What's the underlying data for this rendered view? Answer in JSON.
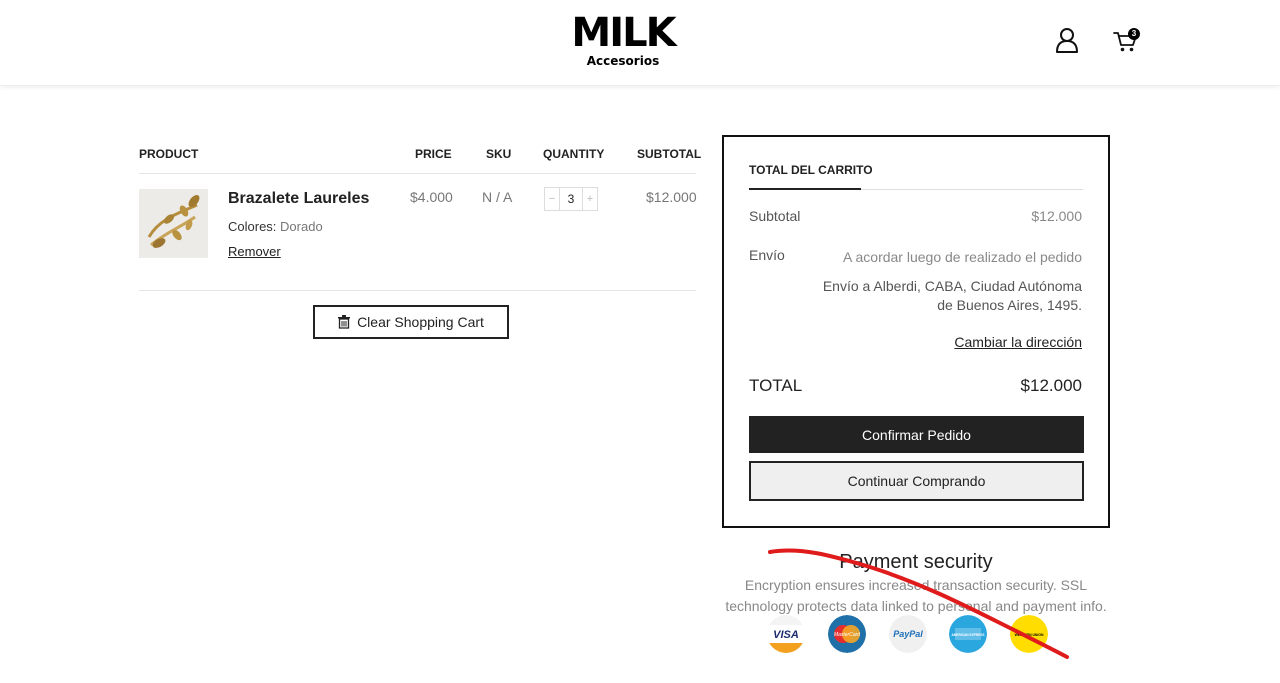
{
  "header": {
    "logo_main": "MILK",
    "logo_sub": "Accesorios",
    "cart_count": "3"
  },
  "cart_table": {
    "headers": {
      "product": "PRODUCT",
      "price": "PRICE",
      "sku": "SKU",
      "quantity": "QUANTITY",
      "subtotal": "SUBTOTAL"
    },
    "item": {
      "name": "Brazalete Laureles",
      "attr_label": "Colores:",
      "attr_value": "Dorado",
      "remove_label": "Remover",
      "price": "$4.000",
      "sku": "N / A",
      "quantity": "3",
      "subtotal": "$12.000"
    },
    "clear_label": "Clear Shopping Cart"
  },
  "totals": {
    "title": "TOTAL DEL CARRITO",
    "subtotal_label": "Subtotal",
    "subtotal_value": "$12.000",
    "shipping_label": "Envío",
    "shipping_note": "A acordar luego de realizado el pedido",
    "shipping_address": "Envío a Alberdi, CABA, Ciudad Autónoma de Buenos Aires, 1495.",
    "change_address": "Cambiar la dirección",
    "total_label": "TOTAL",
    "total_value": "$12.000",
    "confirm_label": "Confirmar Pedido",
    "continue_label": "Continuar Comprando"
  },
  "payment": {
    "title": "Payment security",
    "text": "Encryption ensures increased transaction security. SSL technology protects data linked to personal and payment info.",
    "methods": [
      {
        "name": "VISA",
        "icon": "visa-icon"
      },
      {
        "name": "MasterCard",
        "icon": "mastercard-icon"
      },
      {
        "name": "PayPal",
        "icon": "paypal-icon"
      },
      {
        "name": "AMERICAN EXPRESS",
        "icon": "amex-icon"
      },
      {
        "name": "WESTERN UNION",
        "icon": "western-union-icon"
      }
    ]
  },
  "colors": {
    "scribble": "#e01b1b",
    "primary_button": "#222222"
  }
}
